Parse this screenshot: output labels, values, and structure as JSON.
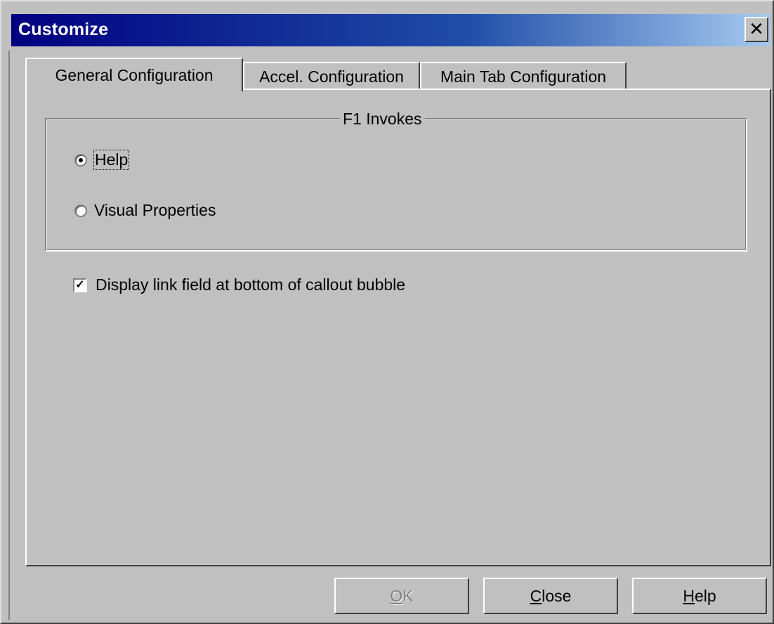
{
  "window": {
    "title": "Customize",
    "close_glyph": "✕"
  },
  "tabs": [
    {
      "label": "General Configuration",
      "active": true
    },
    {
      "label": "Accel. Configuration",
      "active": false
    },
    {
      "label": "Main Tab Configuration",
      "active": false
    }
  ],
  "group": {
    "label": "F1 Invokes",
    "options": [
      {
        "label": "Help",
        "selected": true
      },
      {
        "label": "Visual Properties",
        "selected": false
      }
    ]
  },
  "checkbox": {
    "label": "Display link field at bottom of callout bubble",
    "checked": true,
    "check_glyph": "✓"
  },
  "buttons": {
    "ok": {
      "mnemonic": "O",
      "rest": "K",
      "enabled": false
    },
    "close": {
      "mnemonic": "C",
      "rest": "lose",
      "enabled": true
    },
    "help": {
      "mnemonic": "H",
      "rest": "elp",
      "enabled": true
    }
  },
  "colors": {
    "title_start": "#000080",
    "face": "#c0c0c0"
  }
}
